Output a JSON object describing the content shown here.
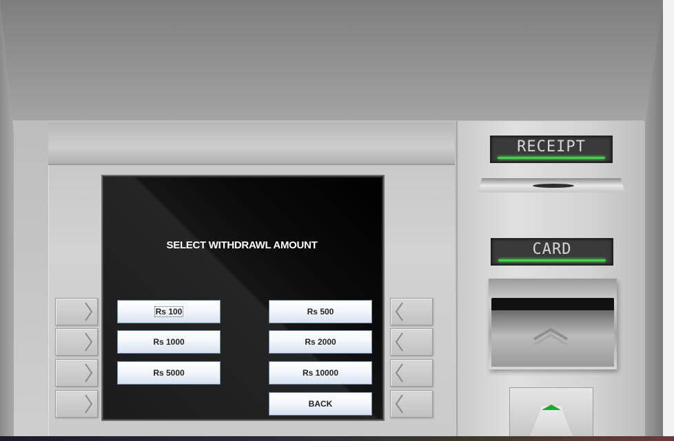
{
  "screen": {
    "title": "SELECT WITHDRAWL AMOUNT",
    "amounts_left": [
      "Rs 100",
      "Rs 1000",
      "Rs 5000"
    ],
    "amounts_right": [
      "Rs 500",
      "Rs 2000",
      "Rs 10000"
    ],
    "back_label": "BACK"
  },
  "slots": {
    "receipt_label": "RECEIPT",
    "card_label": "CARD"
  },
  "colors": {
    "screen_bg": "#000000",
    "indicator_led": "#3fd34a",
    "button_top": "#ffffff",
    "button_bottom": "#d6e2ef"
  }
}
